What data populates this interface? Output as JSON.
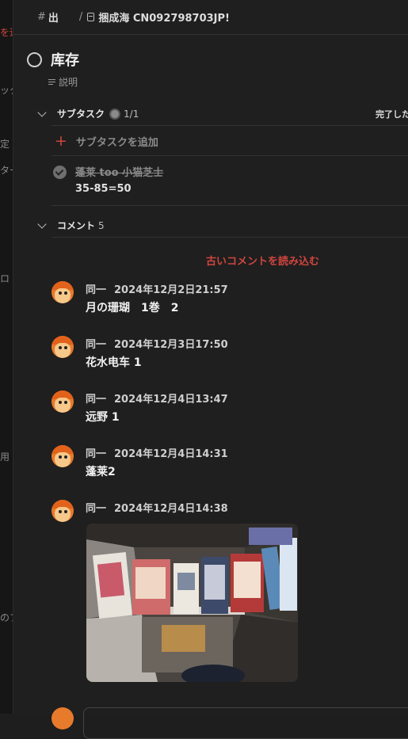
{
  "topbar": {
    "project": "出",
    "task_ref": "捆成海 CN092798703JP!"
  },
  "task": {
    "title": "库存",
    "description_label": "説明"
  },
  "subtasks": {
    "header": "サブタスク",
    "count": "1/1",
    "done_label": "完了した",
    "add_label": "サブタスクを追加",
    "items": [
      {
        "name": "蓬莱 too 小猫芝士",
        "description": "35-85=50",
        "completed": true
      }
    ]
  },
  "comments": {
    "header": "コメント",
    "count": "5",
    "load_older": "古いコメントを読み込む",
    "items": [
      {
        "author": "同一",
        "timestamp": "2024年12月2日21:57",
        "text": "月の珊瑚　1巻　2"
      },
      {
        "author": "同一",
        "timestamp": "2024年12月3日17:50",
        "text": "花水电车 1"
      },
      {
        "author": "同一",
        "timestamp": "2024年12月4日13:47",
        "text": "远野 1"
      },
      {
        "author": "同一",
        "timestamp": "2024年12月4日14:31",
        "text": "蓬莱2"
      },
      {
        "author": "同一",
        "timestamp": "2024年12月4日14:38",
        "text": ""
      }
    ]
  },
  "backdrop": {
    "fragments": [
      "を追",
      "ック",
      "定",
      "ター",
      "ロ",
      "用",
      "のフ"
    ]
  },
  "colors": {
    "accent": "#d0453e",
    "background": "#1f1f1f",
    "avatar": "#e87a2c"
  }
}
